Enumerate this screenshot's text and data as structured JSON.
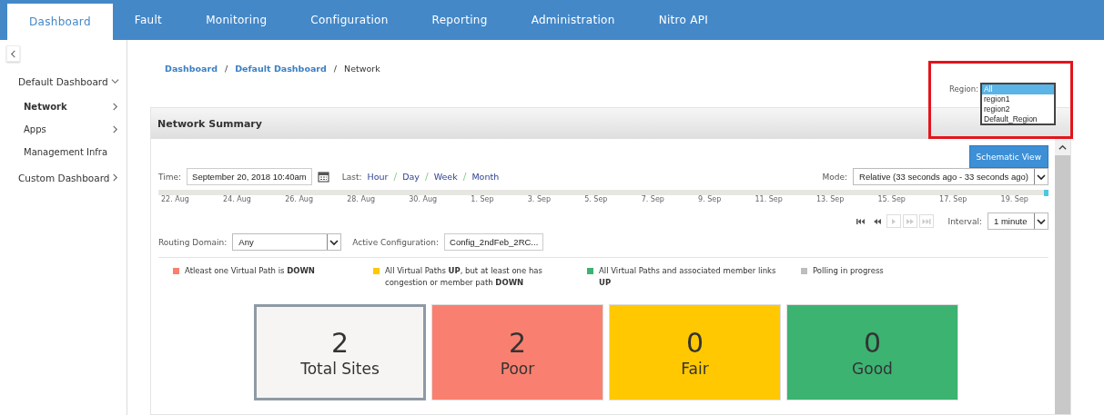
{
  "nav_tabs": [
    {
      "label": "Dashboard",
      "selected": true
    },
    {
      "label": "Fault",
      "selected": false
    },
    {
      "label": "Monitoring",
      "selected": false
    },
    {
      "label": "Configuration",
      "selected": false
    },
    {
      "label": "Reporting",
      "selected": false
    },
    {
      "label": "Administration",
      "selected": false
    },
    {
      "label": "Nitro API",
      "selected": false
    }
  ],
  "sidebar": {
    "items": [
      {
        "label": "Default Dashboard",
        "expanded": true,
        "selected": false,
        "children": [
          {
            "label": "Network",
            "expanded": false,
            "selected": true
          },
          {
            "label": "Apps",
            "expanded": false,
            "selected": false
          },
          {
            "label": "Management Infra",
            "selected": false
          }
        ]
      },
      {
        "label": "Custom Dashboard",
        "expanded": false,
        "selected": false
      }
    ]
  },
  "breadcrumb": [
    {
      "kind": "link",
      "text": "Dashboard"
    },
    {
      "kind": "separator",
      "text": "/"
    },
    {
      "kind": "link",
      "text": "Default Dashboard"
    },
    {
      "kind": "separator",
      "text": "/"
    },
    {
      "kind": "current",
      "text": "Network"
    }
  ],
  "region": {
    "label": "Region:",
    "options": [
      {
        "label": "All",
        "selected": true
      },
      {
        "label": "region1",
        "selected": false
      },
      {
        "label": "region2",
        "selected": false
      },
      {
        "label": "Default_Region",
        "selected": false
      }
    ]
  },
  "panel": {
    "title": "Network Summary",
    "schematic_button": "Schematic View",
    "time_label": "Time:",
    "time_value": "September 20, 2018 10:40am",
    "last_label": "Last:",
    "ranges": [
      {
        "kind": "link",
        "text": "Hour"
      },
      {
        "kind": "separator",
        "text": "/"
      },
      {
        "kind": "link",
        "text": "Day"
      },
      {
        "kind": "separator",
        "text": "/"
      },
      {
        "kind": "link",
        "text": "Week"
      },
      {
        "kind": "separator",
        "text": "/"
      },
      {
        "kind": "link",
        "text": "Month"
      }
    ],
    "mode_label": "Mode:",
    "mode_value": "Relative (33 seconds ago - 33 seconds ago)",
    "timeline_labels": [
      "22. Aug",
      "24. Aug",
      "26. Aug",
      "28. Aug",
      "30. Aug",
      "1. Sep",
      "3. Sep",
      "5. Sep",
      "7. Sep",
      "9. Sep",
      "11. Sep",
      "13. Sep",
      "15. Sep",
      "17. Sep",
      "19. Sep"
    ],
    "playback": [
      {
        "kind": "first",
        "disabled": false
      },
      {
        "kind": "back",
        "disabled": false
      },
      {
        "kind": "play",
        "disabled": true
      },
      {
        "kind": "forward",
        "disabled": true
      },
      {
        "kind": "last",
        "disabled": true
      }
    ],
    "interval_label": "Interval:",
    "interval_value": "1 minute",
    "routing_label": "Routing Domain:",
    "routing_value": "Any",
    "config_label": "Active Configuration:",
    "config_value": "Config_2ndFeb_2RC...",
    "legend": [
      {
        "color": "#f98070",
        "text": "Atleast one Virtual Path is **DOWN**"
      },
      {
        "color": "#ffc800",
        "text": "All Virtual Paths **UP**, but at least one has congestion or member path **DOWN**"
      },
      {
        "color": "#3cb371",
        "text": "All Virtual Paths and associated member links **UP**"
      },
      {
        "color": "#bdbdbd",
        "text": "Polling in progress"
      }
    ],
    "tiles": [
      {
        "kind": "total",
        "value": "2",
        "label": "Total Sites"
      },
      {
        "kind": "status",
        "color": "#f98070",
        "value": "2",
        "label": "Poor"
      },
      {
        "kind": "status",
        "color": "#ffc800",
        "value": "0",
        "label": "Fair"
      },
      {
        "kind": "status",
        "color": "#3cb371",
        "value": "0",
        "label": "Good"
      }
    ]
  }
}
